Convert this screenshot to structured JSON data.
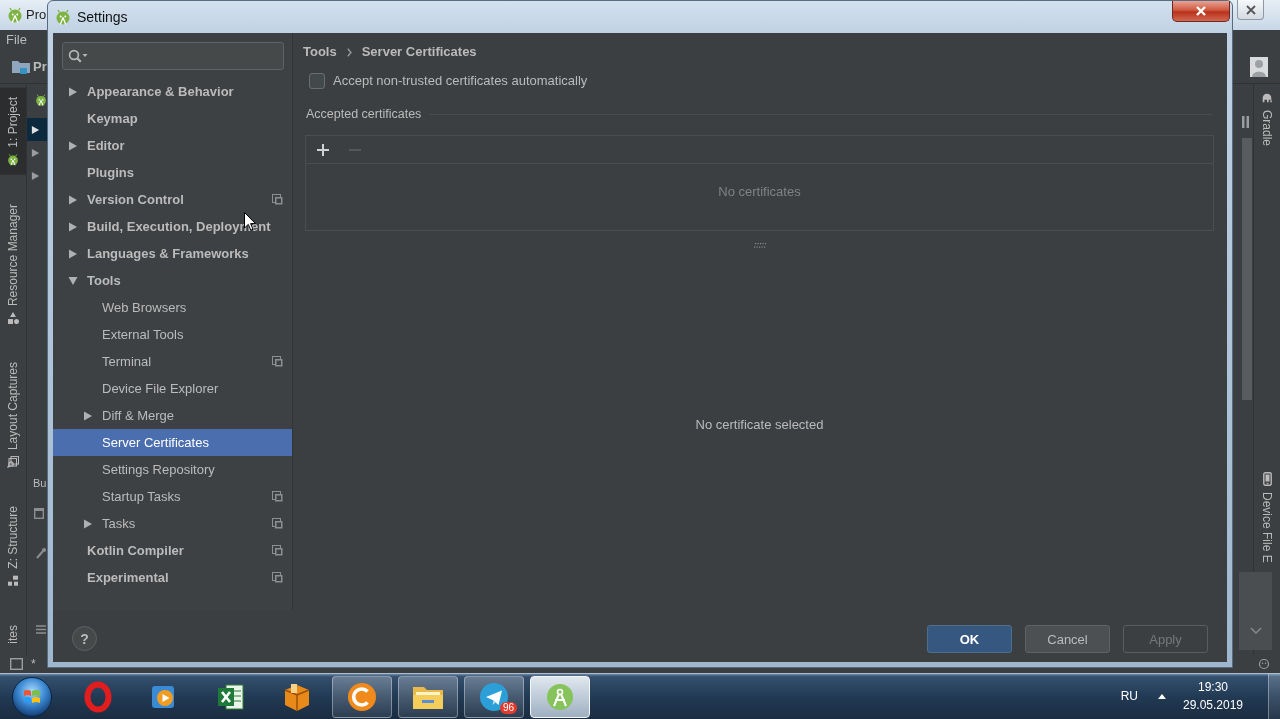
{
  "ide": {
    "title": "Pro",
    "menu": [
      "File"
    ],
    "toolbar_label": "Pr",
    "left_tool_windows": [
      {
        "label": "1: Project",
        "selected": true
      },
      {
        "label": "Resource Manager",
        "selected": false
      },
      {
        "label": "Layout Captures",
        "selected": false
      },
      {
        "label": "Z: Structure",
        "selected": false
      },
      {
        "label": "ites",
        "selected": false
      }
    ],
    "panel_label": "Bu",
    "right_tool_windows": [
      {
        "label": "Gradle"
      },
      {
        "label": "Device File E"
      }
    ],
    "status_mark": "*"
  },
  "dialog": {
    "title": "Settings",
    "tree": [
      {
        "label": "Appearance & Behavior",
        "expanded": false,
        "selected": false,
        "project_scope": false
      },
      {
        "label": "Keymap",
        "selected": false,
        "project_scope": false
      },
      {
        "label": "Editor",
        "expanded": false,
        "selected": false,
        "project_scope": false
      },
      {
        "label": "Plugins",
        "selected": false,
        "project_scope": false
      },
      {
        "label": "Version Control",
        "expanded": false,
        "selected": false,
        "project_scope": true
      },
      {
        "label": "Build, Execution, Deployment",
        "expanded": false,
        "selected": false,
        "project_scope": false
      },
      {
        "label": "Languages & Frameworks",
        "expanded": false,
        "selected": false,
        "project_scope": false
      },
      {
        "label": "Tools",
        "expanded": true,
        "selected": false,
        "project_scope": false,
        "children": [
          {
            "label": "Web Browsers",
            "selected": false,
            "project_scope": false
          },
          {
            "label": "External Tools",
            "selected": false,
            "project_scope": false
          },
          {
            "label": "Terminal",
            "selected": false,
            "project_scope": true
          },
          {
            "label": "Device File Explorer",
            "selected": false,
            "project_scope": false
          },
          {
            "label": "Diff & Merge",
            "expanded": false,
            "selected": false,
            "project_scope": false
          },
          {
            "label": "Server Certificates",
            "selected": true,
            "project_scope": false
          },
          {
            "label": "Settings Repository",
            "selected": false,
            "project_scope": false
          },
          {
            "label": "Startup Tasks",
            "selected": false,
            "project_scope": true
          },
          {
            "label": "Tasks",
            "expanded": false,
            "selected": false,
            "project_scope": true
          }
        ]
      },
      {
        "label": "Kotlin Compiler",
        "selected": false,
        "project_scope": true
      },
      {
        "label": "Experimental",
        "selected": false,
        "project_scope": true
      }
    ],
    "breadcrumb": [
      "Tools",
      "Server Certificates"
    ],
    "auto_accept": {
      "label": "Accept non-trusted certificates automatically",
      "checked": false
    },
    "certificates": {
      "title": "Accepted certificates",
      "toolbar": [
        {
          "kind": "add",
          "disabled": false
        },
        {
          "kind": "remove",
          "disabled": true
        }
      ],
      "empty_text": "No certificates"
    },
    "details": {
      "empty_text": "No certificate selected"
    },
    "help": "?",
    "buttons": [
      {
        "label": "OK",
        "kind": "primary",
        "disabled": false
      },
      {
        "label": "Cancel",
        "kind": "secondary",
        "disabled": false
      },
      {
        "label": "Apply",
        "kind": "secondary",
        "disabled": true
      }
    ]
  },
  "taskbar": {
    "apps": [
      {
        "running": false,
        "active": false
      },
      {
        "running": false,
        "active": false
      },
      {
        "running": false,
        "active": false
      },
      {
        "running": false,
        "active": false
      },
      {
        "running": true,
        "active": false
      },
      {
        "running": true,
        "active": false
      },
      {
        "running": true,
        "active": false,
        "badge": "96"
      },
      {
        "running": true,
        "active": true
      }
    ],
    "language": "RU",
    "time": "19:30",
    "date": "29.05.2019"
  }
}
